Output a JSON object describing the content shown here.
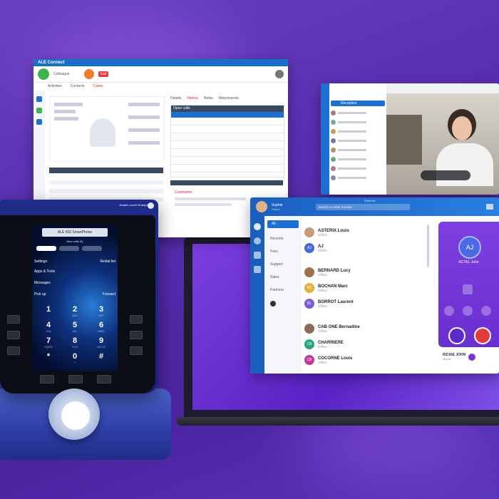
{
  "crm_window": {
    "title": "ALE Connect",
    "user_label": "Colleague",
    "end_call_label": "End",
    "tabs": [
      "Activities",
      "Contacts",
      "Cases"
    ],
    "right_tabs": [
      "Details",
      "History",
      "Notes",
      "Attachments"
    ],
    "grid_header": "Open calls",
    "section_label": "Details",
    "comments_label": "Comments"
  },
  "video_window": {
    "contact_selected": "Reception"
  },
  "softphone_window": {
    "app_title": "Rainbow",
    "search_placeholder": "Search or enter number",
    "user_name": "Sophie",
    "user_status": "Online",
    "nav_items": [
      "All",
      "Recents",
      "Favs",
      "Support",
      "Sales",
      "Partners"
    ],
    "contacts": [
      {
        "name": "ASTERIX Louis",
        "sub": "Online",
        "color": "#c59b7a",
        "initials": ""
      },
      {
        "name": "AJ",
        "sub": "Offline",
        "color": "#4a69d8",
        "initials": "AJ"
      },
      {
        "name": "BERNARD Lucy",
        "sub": "Offline",
        "color": "#a0714e",
        "initials": ""
      },
      {
        "name": "BOCHAN Marc",
        "sub": "Offline",
        "color": "#e3b03c",
        "initials": "BC"
      },
      {
        "name": "BORROT Laurent",
        "sub": "Offline",
        "color": "#7d5ad8",
        "initials": "BL"
      },
      {
        "name": "CAB ONE Bernadine",
        "sub": "Offline",
        "color": "#8b6b5a",
        "initials": ""
      },
      {
        "name": "CHARRIERE",
        "sub": "Offline",
        "color": "#2ba67a",
        "initials": "CB"
      },
      {
        "name": "COCORNE Louis",
        "sub": "Offline",
        "color": "#c0389a",
        "initials": "CB"
      }
    ],
    "call_card": {
      "initials": "AJ",
      "name": "ACTEL John",
      "footer_name": "RICHIE JOHN",
      "footer_sub": "Mobile"
    }
  },
  "desk_phone": {
    "brand": "Alcatel-Lucent Enterprise",
    "screen_title": "ALE 500 SmartPhone",
    "screen_sub": "New calls (0)",
    "menu_left": [
      "Settings",
      "Apps & Tools",
      "Messages",
      "Pick up"
    ],
    "menu_right": [
      "Redial list",
      "",
      "",
      "Forward"
    ],
    "keypad": [
      {
        "n": "1",
        "s": ""
      },
      {
        "n": "2",
        "s": "ABC"
      },
      {
        "n": "3",
        "s": "DEF"
      },
      {
        "n": "4",
        "s": "GHI"
      },
      {
        "n": "5",
        "s": "JKL"
      },
      {
        "n": "6",
        "s": "MNO"
      },
      {
        "n": "7",
        "s": "PQRS"
      },
      {
        "n": "8",
        "s": "TUV"
      },
      {
        "n": "9",
        "s": "WXYZ"
      },
      {
        "n": "*",
        "s": ""
      },
      {
        "n": "0",
        "s": "+"
      },
      {
        "n": "#",
        "s": ""
      }
    ]
  },
  "colors": {
    "accent_blue": "#1d6fd1",
    "brand_purple": "#7b32d6",
    "end_call_red": "#e23b3b",
    "ok_green": "#3fb34f"
  }
}
